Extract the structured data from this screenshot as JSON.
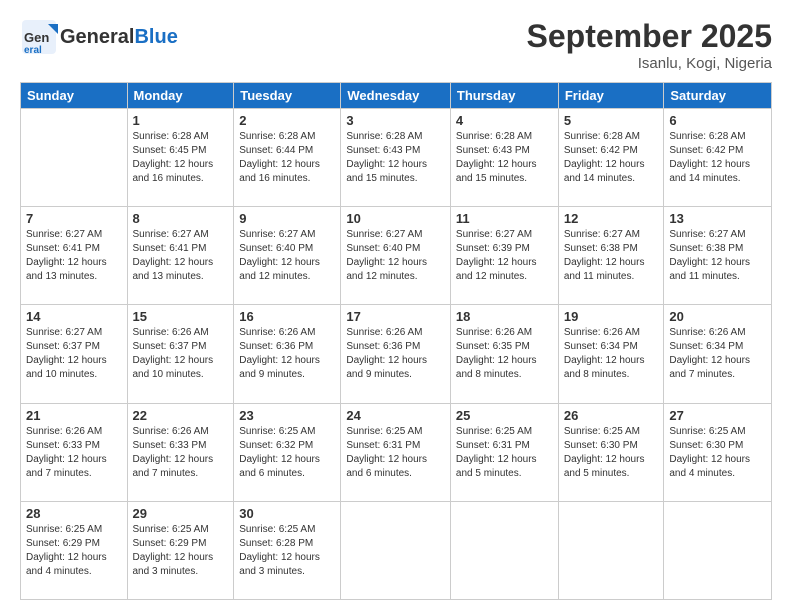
{
  "header": {
    "logo_general": "General",
    "logo_blue": "Blue",
    "title": "September 2025",
    "subtitle": "Isanlu, Kogi, Nigeria"
  },
  "weekdays": [
    "Sunday",
    "Monday",
    "Tuesday",
    "Wednesday",
    "Thursday",
    "Friday",
    "Saturday"
  ],
  "weeks": [
    [
      null,
      {
        "day": "1",
        "sunrise": "6:28 AM",
        "sunset": "6:45 PM",
        "daylight": "12 hours and 16 minutes."
      },
      {
        "day": "2",
        "sunrise": "6:28 AM",
        "sunset": "6:44 PM",
        "daylight": "12 hours and 16 minutes."
      },
      {
        "day": "3",
        "sunrise": "6:28 AM",
        "sunset": "6:43 PM",
        "daylight": "12 hours and 15 minutes."
      },
      {
        "day": "4",
        "sunrise": "6:28 AM",
        "sunset": "6:43 PM",
        "daylight": "12 hours and 15 minutes."
      },
      {
        "day": "5",
        "sunrise": "6:28 AM",
        "sunset": "6:42 PM",
        "daylight": "12 hours and 14 minutes."
      },
      {
        "day": "6",
        "sunrise": "6:28 AM",
        "sunset": "6:42 PM",
        "daylight": "12 hours and 14 minutes."
      }
    ],
    [
      {
        "day": "7",
        "sunrise": "6:27 AM",
        "sunset": "6:41 PM",
        "daylight": "12 hours and 13 minutes."
      },
      {
        "day": "8",
        "sunrise": "6:27 AM",
        "sunset": "6:41 PM",
        "daylight": "12 hours and 13 minutes."
      },
      {
        "day": "9",
        "sunrise": "6:27 AM",
        "sunset": "6:40 PM",
        "daylight": "12 hours and 12 minutes."
      },
      {
        "day": "10",
        "sunrise": "6:27 AM",
        "sunset": "6:40 PM",
        "daylight": "12 hours and 12 minutes."
      },
      {
        "day": "11",
        "sunrise": "6:27 AM",
        "sunset": "6:39 PM",
        "daylight": "12 hours and 12 minutes."
      },
      {
        "day": "12",
        "sunrise": "6:27 AM",
        "sunset": "6:38 PM",
        "daylight": "12 hours and 11 minutes."
      },
      {
        "day": "13",
        "sunrise": "6:27 AM",
        "sunset": "6:38 PM",
        "daylight": "12 hours and 11 minutes."
      }
    ],
    [
      {
        "day": "14",
        "sunrise": "6:27 AM",
        "sunset": "6:37 PM",
        "daylight": "12 hours and 10 minutes."
      },
      {
        "day": "15",
        "sunrise": "6:26 AM",
        "sunset": "6:37 PM",
        "daylight": "12 hours and 10 minutes."
      },
      {
        "day": "16",
        "sunrise": "6:26 AM",
        "sunset": "6:36 PM",
        "daylight": "12 hours and 9 minutes."
      },
      {
        "day": "17",
        "sunrise": "6:26 AM",
        "sunset": "6:36 PM",
        "daylight": "12 hours and 9 minutes."
      },
      {
        "day": "18",
        "sunrise": "6:26 AM",
        "sunset": "6:35 PM",
        "daylight": "12 hours and 8 minutes."
      },
      {
        "day": "19",
        "sunrise": "6:26 AM",
        "sunset": "6:34 PM",
        "daylight": "12 hours and 8 minutes."
      },
      {
        "day": "20",
        "sunrise": "6:26 AM",
        "sunset": "6:34 PM",
        "daylight": "12 hours and 7 minutes."
      }
    ],
    [
      {
        "day": "21",
        "sunrise": "6:26 AM",
        "sunset": "6:33 PM",
        "daylight": "12 hours and 7 minutes."
      },
      {
        "day": "22",
        "sunrise": "6:26 AM",
        "sunset": "6:33 PM",
        "daylight": "12 hours and 7 minutes."
      },
      {
        "day": "23",
        "sunrise": "6:25 AM",
        "sunset": "6:32 PM",
        "daylight": "12 hours and 6 minutes."
      },
      {
        "day": "24",
        "sunrise": "6:25 AM",
        "sunset": "6:31 PM",
        "daylight": "12 hours and 6 minutes."
      },
      {
        "day": "25",
        "sunrise": "6:25 AM",
        "sunset": "6:31 PM",
        "daylight": "12 hours and 5 minutes."
      },
      {
        "day": "26",
        "sunrise": "6:25 AM",
        "sunset": "6:30 PM",
        "daylight": "12 hours and 5 minutes."
      },
      {
        "day": "27",
        "sunrise": "6:25 AM",
        "sunset": "6:30 PM",
        "daylight": "12 hours and 4 minutes."
      }
    ],
    [
      {
        "day": "28",
        "sunrise": "6:25 AM",
        "sunset": "6:29 PM",
        "daylight": "12 hours and 4 minutes."
      },
      {
        "day": "29",
        "sunrise": "6:25 AM",
        "sunset": "6:29 PM",
        "daylight": "12 hours and 3 minutes."
      },
      {
        "day": "30",
        "sunrise": "6:25 AM",
        "sunset": "6:28 PM",
        "daylight": "12 hours and 3 minutes."
      },
      null,
      null,
      null,
      null
    ]
  ]
}
